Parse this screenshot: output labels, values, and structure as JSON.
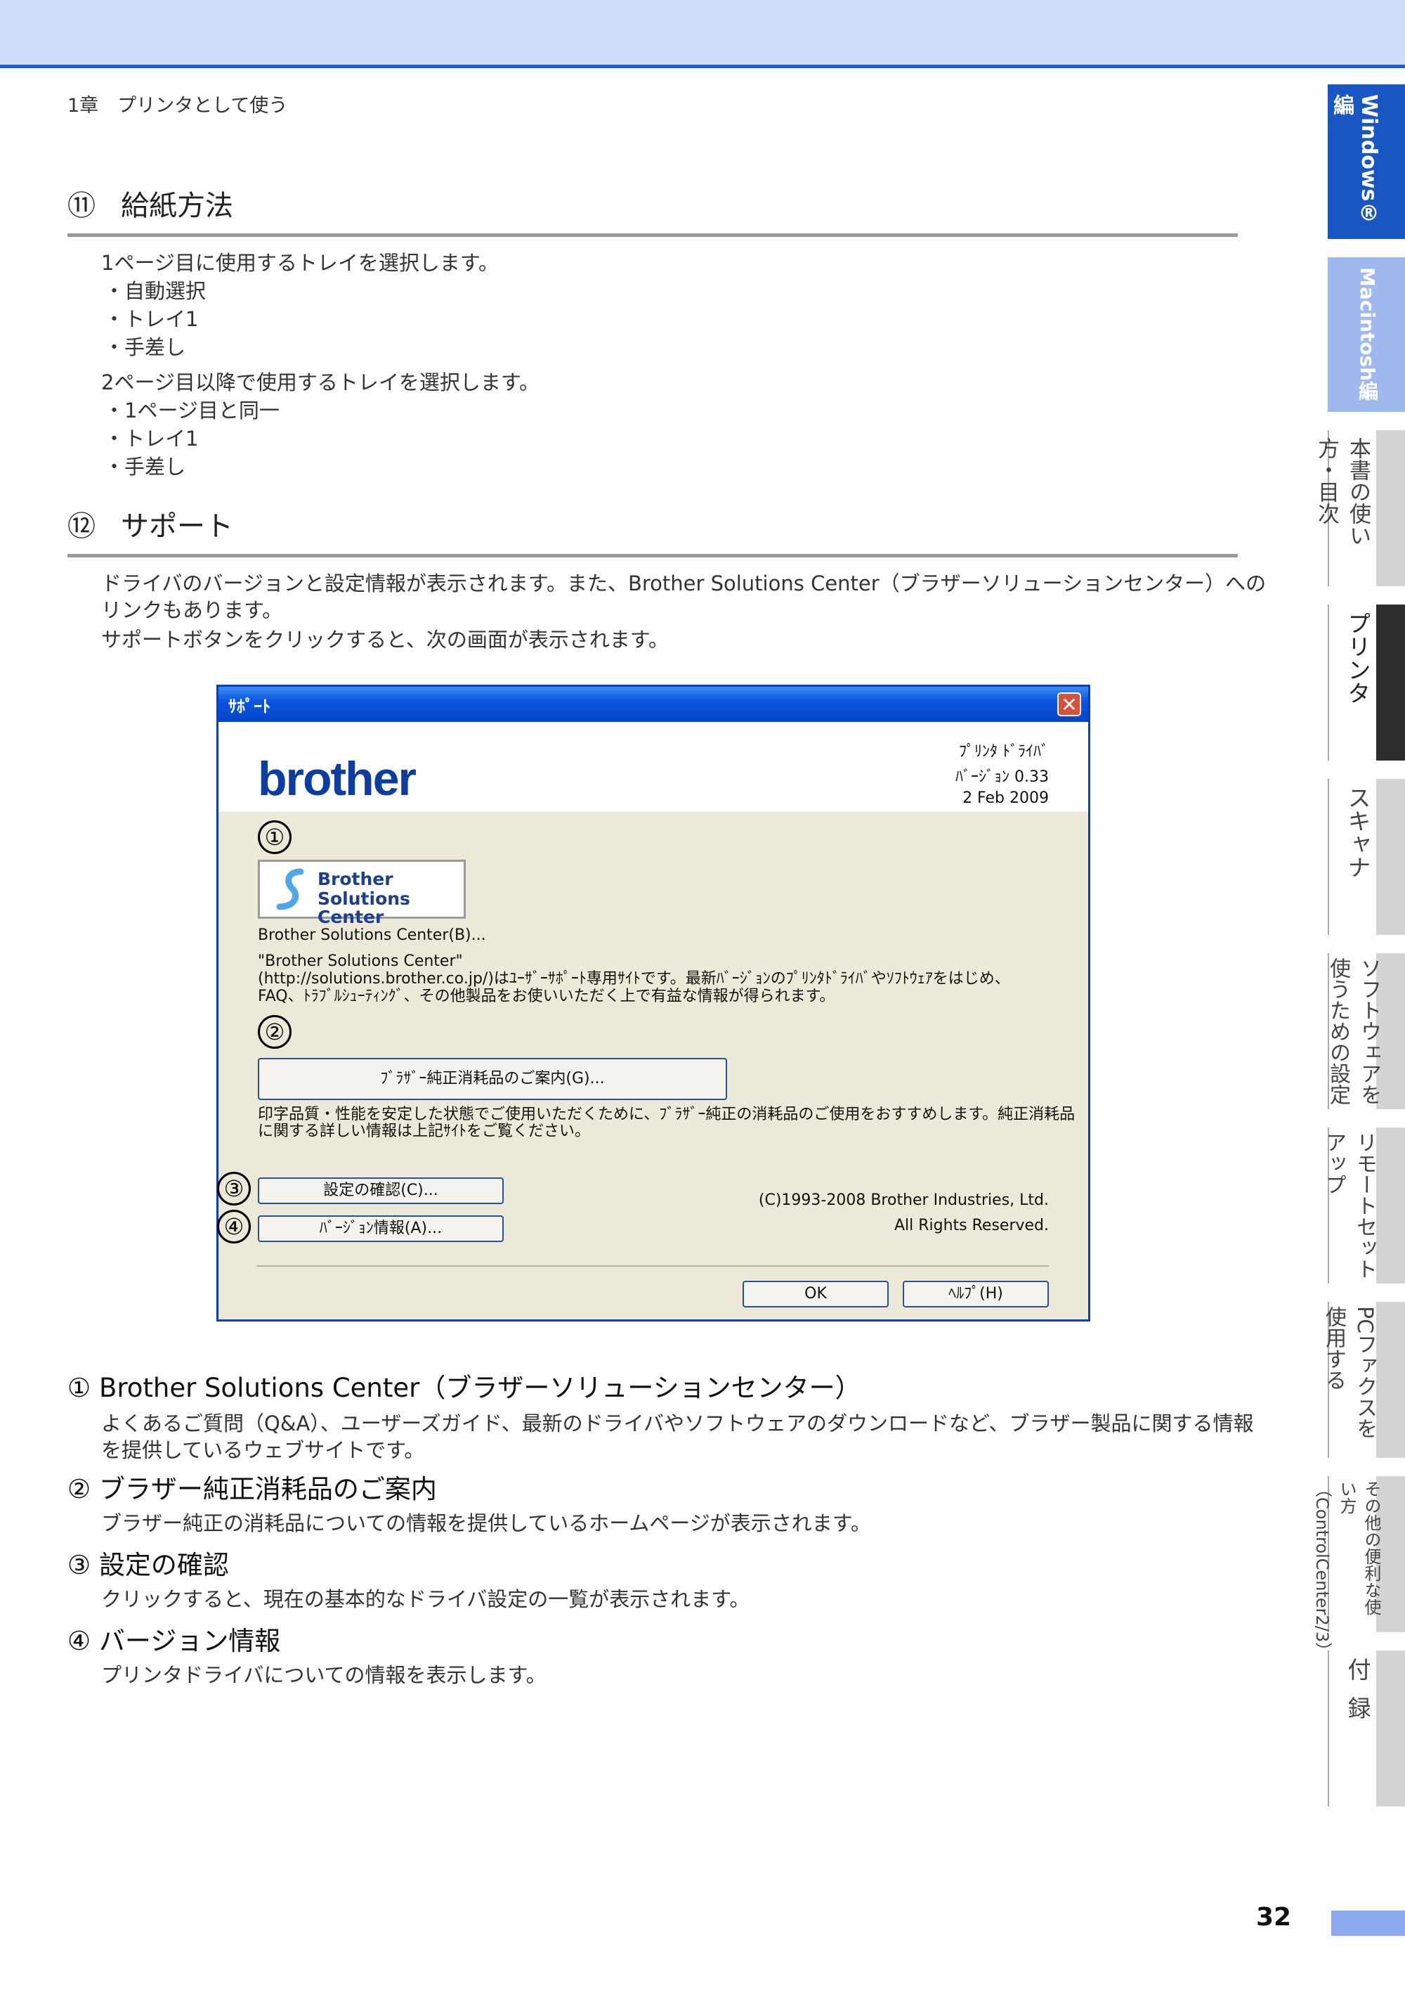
{
  "header": {
    "chapter": "1章　プリンタとして使う"
  },
  "section11": {
    "num": "⑪",
    "title": "給紙方法",
    "p1": "1ページ目に使用するトレイを選択します。",
    "list1": [
      "自動選択",
      "トレイ1",
      "手差し"
    ],
    "p2": "2ページ目以降で使用するトレイを選択します。",
    "list2": [
      "1ページ目と同一",
      "トレイ1",
      "手差し"
    ]
  },
  "section12": {
    "num": "⑫",
    "title": "サポート",
    "p1a": "ドライバのバージョンと設定情報が表示されます。また、Brother Solutions Center（ブラザーソリューションセンター）への",
    "p1b": "リンクもあります。",
    "p2": "サポートボタンをクリックすると、次の画面が表示されます。"
  },
  "dialog": {
    "title": "ｻﾎﾟｰﾄ",
    "close": "✕",
    "logo": "brother",
    "driver_label": "ﾌﾟﾘﾝﾀ ﾄﾞﾗｲﾊﾞ",
    "version": "ﾊﾞｰｼﾞｮﾝ 0.33",
    "date": "2 Feb 2009",
    "markers": [
      "①",
      "②",
      "③",
      "④"
    ],
    "bsc_line1": "Brother",
    "bsc_line2": "Solutions Center",
    "bsc_link": "Brother Solutions Center(B)...",
    "bsc_desc1": "\"Brother Solutions Center\"",
    "bsc_desc2": "(http://solutions.brother.co.jp/)はﾕｰｻﾞｰｻﾎﾟｰﾄ専用ｻｲﾄです。最新ﾊﾞｰｼﾞｮﾝのﾌﾟﾘﾝﾀﾄﾞﾗｲﾊﾞやｿﾌﾄｳｪｱをはじめ、",
    "bsc_desc3": "FAQ、ﾄﾗﾌﾞﾙｼｭｰﾃｨﾝｸﾞ、その他製品をお使いいただく上で有益な情報が得られます。",
    "supplies_button": "ﾌﾞﾗｻﾞｰ純正消耗品のご案内(G)...",
    "supplies_desc1": "印字品質・性能を安定した状態でご使用いただくために、ﾌﾞﾗｻﾞｰ純正の消耗品のご使用をおすすめします。純正消耗品",
    "supplies_desc2": "に関する詳しい情報は上記ｻｲﾄをご覧ください。",
    "settings_button": "設定の確認(C)...",
    "version_button": "ﾊﾞｰｼﾞｮﾝ情報(A)...",
    "copyright": "(C)1993-2008 Brother Industries, Ltd.",
    "rights": "All Rights Reserved.",
    "ok": "OK",
    "help": "ﾍﾙﾌﾟ(H)"
  },
  "items": [
    {
      "num": "①",
      "title": "Brother Solutions Center（ブラザーソリューションセンター）",
      "text1": "よくあるご質問（Q&A）、ユーザーズガイド、最新のドライバやソフトウェアのダウンロードなど、ブラザー製品に関する情報",
      "text2": "を提供しているウェブサイトです。"
    },
    {
      "num": "②",
      "title": "ブラザー純正消耗品のご案内",
      "text1": "ブラザー純正の消耗品についての情報を提供しているホームページが表示されます。"
    },
    {
      "num": "③",
      "title": "設定の確認",
      "text1": "クリックすると、現在の基本的なドライバ設定の一覧が表示されます。"
    },
    {
      "num": "④",
      "title": "バージョン情報",
      "text1": "プリンタドライバについての情報を表示します。"
    }
  ],
  "tabs": [
    "Windows®編",
    "Macintosh編",
    "本書の使い方・目次",
    "プリンタ",
    "スキャナ",
    "ソフトウェアを使うための設定",
    "リモートセットアップ",
    "PCファクスを使用する",
    "その他の便利な使い方（ControlCenter2/3）",
    "付録"
  ],
  "page_number": "32",
  "colors": {
    "accent": "#1856c4",
    "tab_gray": "#d4d4d4",
    "dialog_bg": "#ece9d8",
    "top_band": "#cfdcf7"
  }
}
